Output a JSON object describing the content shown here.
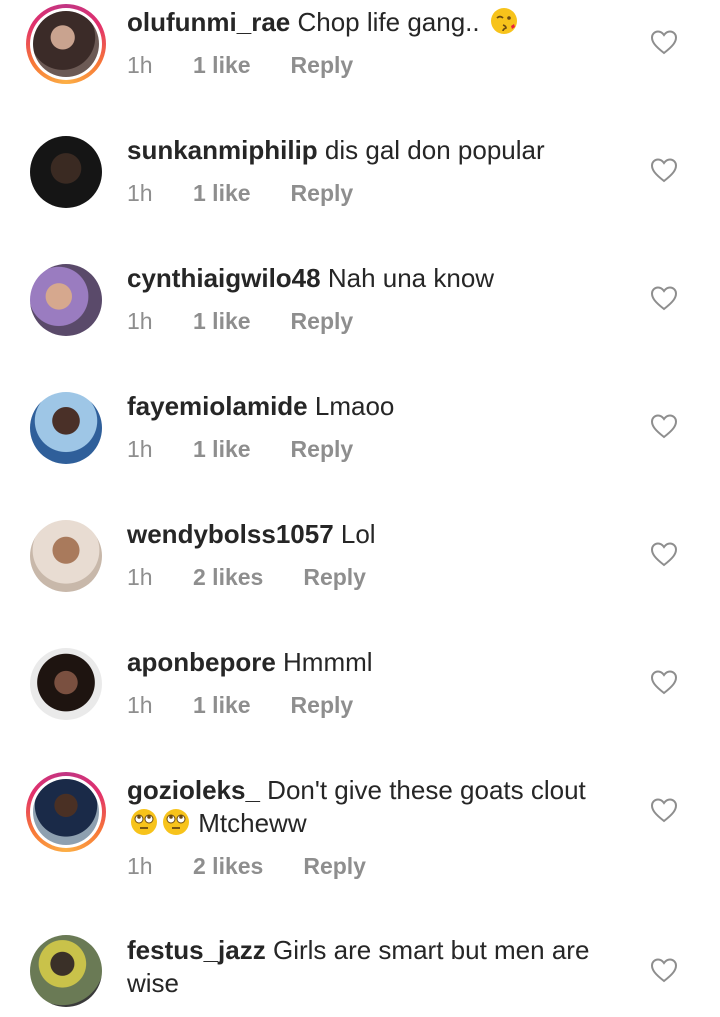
{
  "comments": [
    {
      "username": "olufunmi_rae",
      "text": "Chop life gang..",
      "emoji_after": [
        "kiss-emoji"
      ],
      "time": "1h",
      "likes": "1 like",
      "reply": "Reply",
      "story_ring": true,
      "avatar_color": "#5a4a48"
    },
    {
      "username": "sunkanmiphilip",
      "text": "dis gal don popular",
      "time": "1h",
      "likes": "1 like",
      "reply": "Reply",
      "story_ring": false,
      "avatar_color": "#1e1e1e"
    },
    {
      "username": "cynthiaigwilo48",
      "text": "Nah una know",
      "time": "1h",
      "likes": "1 like",
      "reply": "Reply",
      "story_ring": false,
      "avatar_color": "#8a6fa0"
    },
    {
      "username": "fayemiolamide",
      "text": "Lmaoo",
      "time": "1h",
      "likes": "1 like",
      "reply": "Reply",
      "story_ring": false,
      "avatar_color": "#4e7ba8"
    },
    {
      "username": "wendybolss1057",
      "text": "Lol",
      "time": "1h",
      "likes": "2 likes",
      "reply": "Reply",
      "story_ring": false,
      "avatar_color": "#d9c2b0"
    },
    {
      "username": "aponbepore",
      "text": "Hmmml",
      "time": "1h",
      "likes": "1 like",
      "reply": "Reply",
      "story_ring": false,
      "avatar_color": "#4a3a35"
    },
    {
      "username": "gozioleks_",
      "text": "Don't give these goats clout",
      "text_line2": "Mtcheww",
      "time": "1h",
      "likes": "2 likes",
      "reply": "Reply",
      "story_ring": true,
      "avatar_color": "#2a3550"
    },
    {
      "username": "festus_jazz",
      "text": "Girls are smart but men  are wise",
      "time": "",
      "likes": "",
      "reply": "",
      "story_ring": false,
      "avatar_color": "#6a7a55"
    }
  ],
  "colors": {
    "text": "#262626",
    "meta": "#8e8e8e",
    "heart": "#8e8e8e"
  }
}
